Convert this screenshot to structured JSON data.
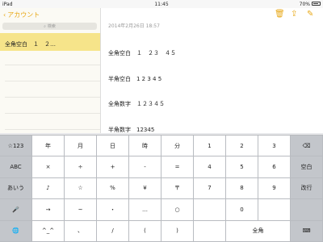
{
  "status_bar": {
    "device": "iPad",
    "wifi_icon": "wifi-icon",
    "time": "11:45",
    "battery": "70%"
  },
  "sidebar": {
    "back_label": "アカウント",
    "search_placeholder": "検索",
    "note_title": "全角空白　１　２…"
  },
  "toolbar": {
    "icons": [
      "trash-icon",
      "share-icon",
      "compose-icon"
    ]
  },
  "note": {
    "date": "2014年2月26日 18:57",
    "lines": [
      "全角空白　１　２３　４５",
      "半角空白　1 2 3 4 5",
      "全角数字　１２３４５",
      "半角数字　12345"
    ]
  },
  "keyboard": {
    "left": [
      "☆123",
      "ABC",
      "あいう",
      "🎤",
      "🌐"
    ],
    "sym_rows": [
      [
        "年",
        "月",
        "日",
        "時",
        "分"
      ],
      [
        "×",
        "÷",
        "+",
        "-",
        "="
      ],
      [
        "♪",
        "☆",
        "%",
        "¥",
        "〒"
      ],
      [
        "→",
        "~",
        "・",
        "…",
        "○"
      ],
      [
        "^_^",
        "、",
        "/",
        "(",
        ")"
      ]
    ],
    "num_rows": [
      [
        "1",
        "2",
        "3"
      ],
      [
        "4",
        "5",
        "6"
      ],
      [
        "7",
        "8",
        "9"
      ],
      [
        "",
        "0",
        ""
      ],
      [
        "",
        "全角",
        ""
      ]
    ],
    "right": [
      "⌫",
      "空白",
      "改行",
      "",
      "⌨"
    ]
  }
}
